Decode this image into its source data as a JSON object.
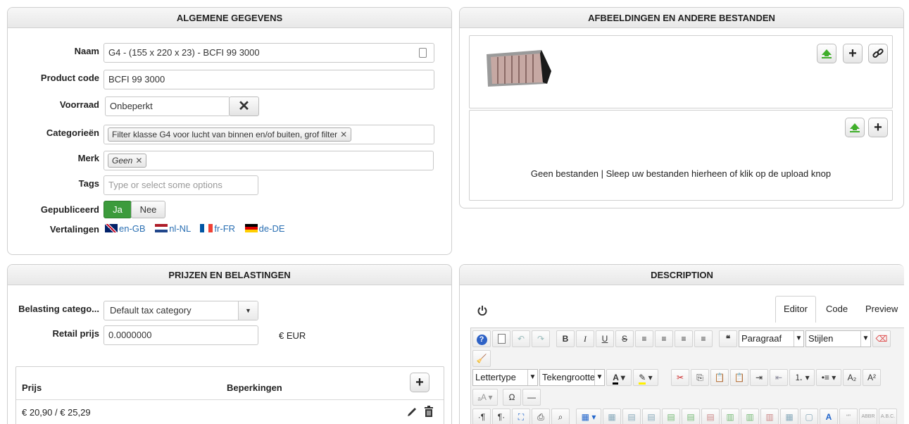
{
  "general": {
    "title": "ALGEMENE GEGEVENS",
    "name_label": "Naam",
    "name_value": "G4 - (155 x 220 x 23) - BCFI 99 3000",
    "code_label": "Product code",
    "code_value": "BCFI 99 3000",
    "stock_label": "Voorraad",
    "stock_value": "Onbeperkt",
    "categories_label": "Categorieën",
    "categories_chip": "Filter klasse G4 voor lucht van binnen en/of buiten, grof filter",
    "brand_label": "Merk",
    "brand_chip": "Geen",
    "tags_label": "Tags",
    "tags_placeholder": "Type or select some options",
    "published_label": "Gepubliceerd",
    "published_yes": "Ja",
    "published_no": "Nee",
    "translations_label": "Vertalingen",
    "translations": [
      "en-GB",
      "nl-NL",
      "fr-FR",
      "de-DE"
    ]
  },
  "files": {
    "title": "AFBEELDINGEN EN ANDERE BESTANDEN",
    "empty_text": "Geen bestanden | Sleep uw bestanden hierheen of klik op de upload knop"
  },
  "prices": {
    "title": "PRIJZEN EN BELASTINGEN",
    "tax_label": "Belasting catego...",
    "tax_value": "Default tax category",
    "retail_label": "Retail prijs",
    "retail_value": "0.0000000",
    "currency": "€ EUR",
    "col_price": "Prijs",
    "col_restrictions": "Beperkingen",
    "row_price": "€ 20,90 / € 25,29"
  },
  "description": {
    "title": "DESCRIPTION",
    "tab_editor": "Editor",
    "tab_code": "Code",
    "tab_preview": "Preview",
    "format_select": "Paragraaf",
    "styles_select": "Stijlen",
    "font_select": "Lettertype",
    "size_select": "Tekengrootte"
  }
}
